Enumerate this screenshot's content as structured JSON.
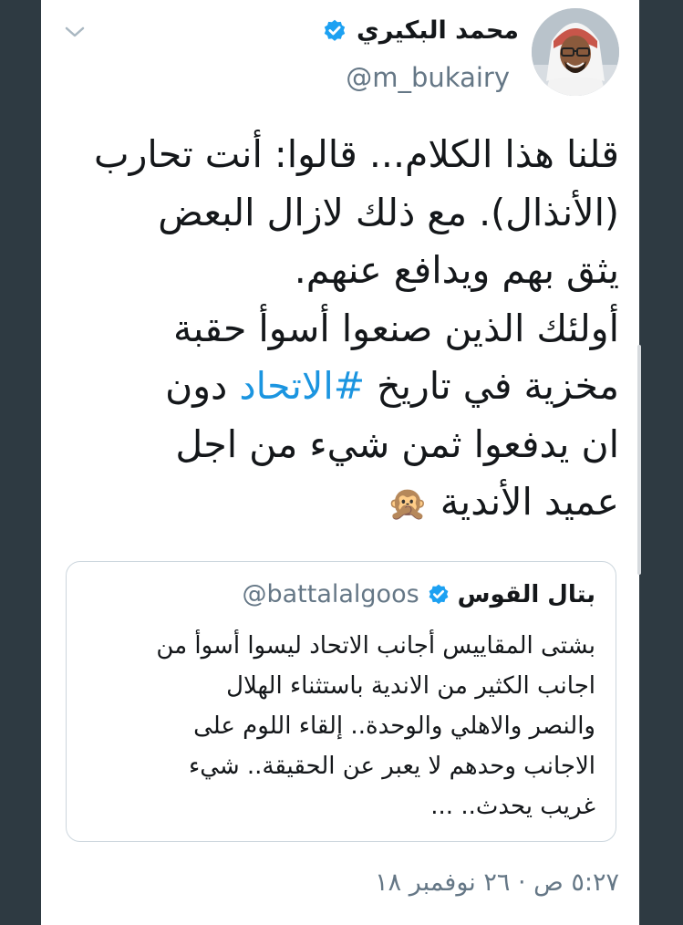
{
  "tweet": {
    "author": {
      "name": "محمد البكيري",
      "handle": "@m_bukairy",
      "verified": true
    },
    "text_lines": [
      {
        "text": "قلنا هذا الكلام... قالوا: أنت تحارب"
      },
      {
        "text": "(الأنذال). مع ذلك لازال البعض"
      },
      {
        "text": "يثق بهم ويدافع عنهم."
      },
      {
        "text": "أولئك الذين صنعوا أسوأ حقبة"
      },
      {
        "before": "مخزية في تاريخ ",
        "hashtag": "#الاتحاد",
        "after": " دون"
      },
      {
        "text": "ان يدفعوا ثمن شيء من اجل"
      },
      {
        "text": "عميد الأندية",
        "emoji": "🙊"
      }
    ],
    "timestamp": "٥:٢٧ ص · ٢٦ نوفمبر ١٨"
  },
  "quote": {
    "author": {
      "name": "بتال القوس",
      "handle": "@battalalgoos",
      "verified": true
    },
    "text_lines": [
      "بشتى المقاييس أجانب الاتحاد ليسوا أسوأ من",
      "اجانب الكثير من الاندية باستثناء الهلال",
      "والنصر والاهلي والوحدة.. إلقاء اللوم على",
      "الاجانب وحدهم لا يعبر عن الحقيقة.. شيء",
      "غريب يحدث.. ..."
    ]
  },
  "icons": {
    "verified": "verified-badge-icon",
    "menu": "chevron-down-icon"
  },
  "colors": {
    "verified_blue": "#1da1f2",
    "hashtag": "#1b95e0",
    "secondary_text": "#657786",
    "primary_text": "#14171a",
    "frame": "#2e3a42"
  }
}
